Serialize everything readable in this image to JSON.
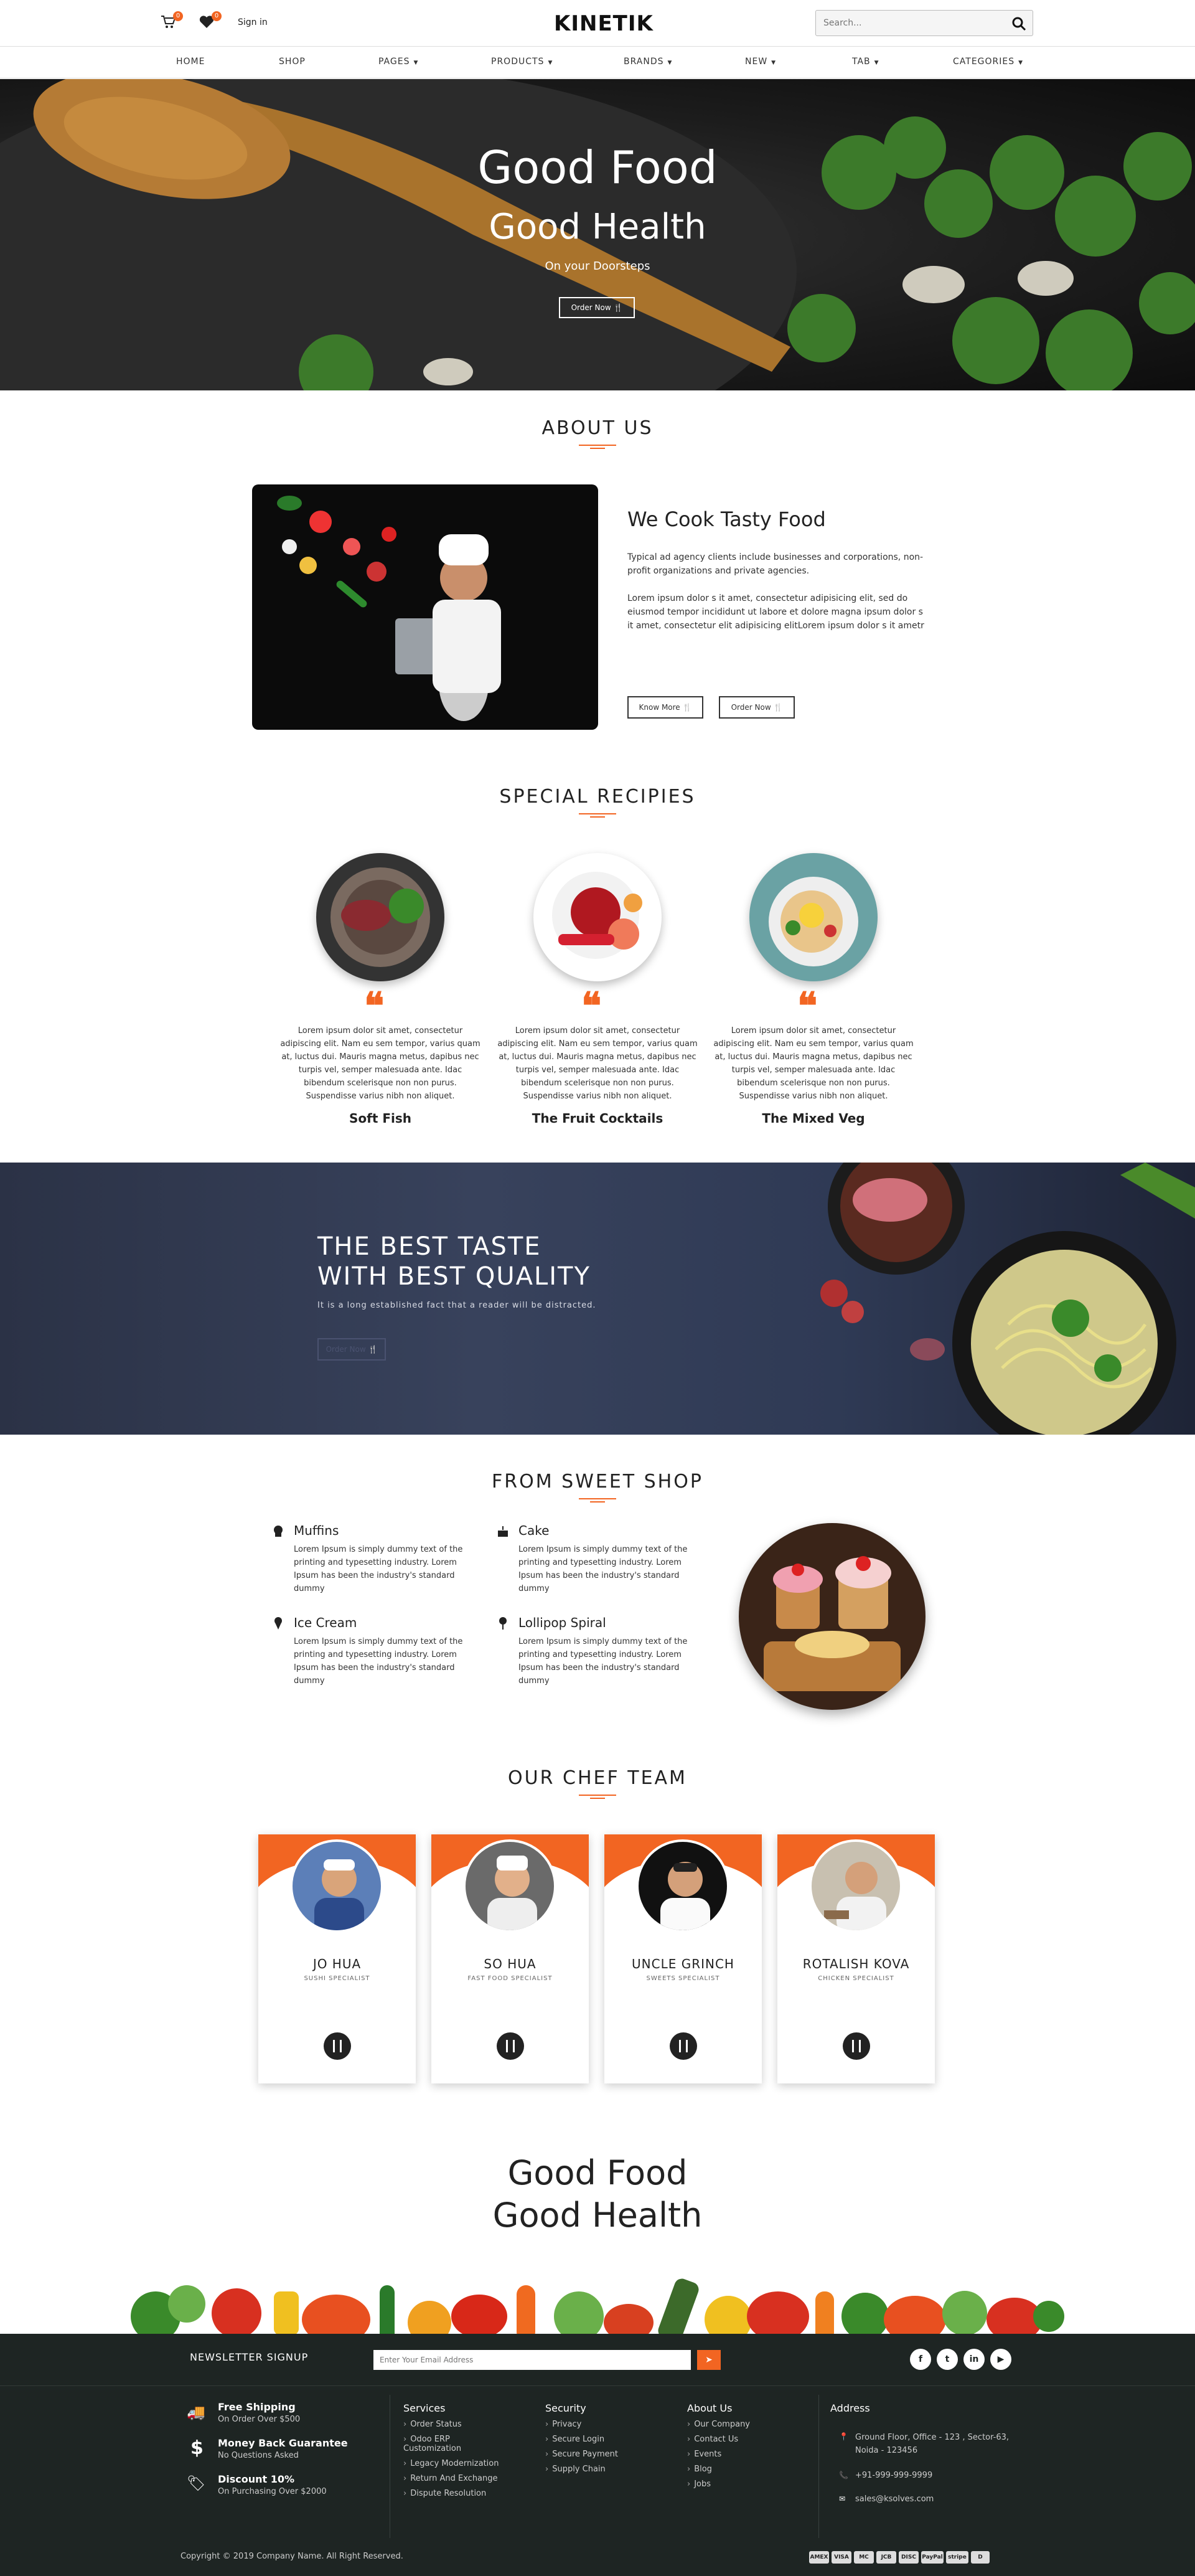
{
  "topbar": {
    "cart_count": "0",
    "wishlist_count": "0",
    "signin": "Sign in",
    "logo": "KINETIK",
    "search_placeholder": "Search..."
  },
  "nav": {
    "items": [
      {
        "label": "HOME",
        "dropdown": false
      },
      {
        "label": "SHOP",
        "dropdown": false
      },
      {
        "label": "PAGES",
        "dropdown": true
      },
      {
        "label": "PRODUCTS",
        "dropdown": true
      },
      {
        "label": "BRANDS",
        "dropdown": true
      },
      {
        "label": "NEW",
        "dropdown": true
      },
      {
        "label": "TAB",
        "dropdown": true
      },
      {
        "label": "CATEGORIES",
        "dropdown": true
      }
    ]
  },
  "hero": {
    "line1": "Good Food",
    "line2": "Good Health",
    "subtitle": "On your Doorsteps",
    "button": "Order Now"
  },
  "about": {
    "title": "ABOUT US",
    "heading": "We Cook Tasty Food",
    "para1": "Typical ad agency clients include businesses and corporations, non-profit organizations and private agencies.",
    "para2": "Lorem ipsum dolor s it amet, consectetur adipisicing elit, sed do eiusmod tempor incididunt ut labore et dolore magna ipsum dolor s it amet, consectetur elit adipisicing elitLorem ipsum dolor s it ametr",
    "btn_know": "Know More",
    "btn_order": "Order Now"
  },
  "recipes": {
    "title": "SPECIAL RECIPIES",
    "items": [
      {
        "name": "Soft Fish",
        "text": "Lorem ipsum dolor sit amet, consectetur adipiscing elit. Nam eu sem tempor, varius quam at, luctus dui. Mauris magna metus, dapibus nec turpis vel, semper malesuada ante. Idac bibendum scelerisque non non purus. Suspendisse varius nibh non aliquet."
      },
      {
        "name": "The Fruit Cocktails",
        "text": "Lorem ipsum dolor sit amet, consectetur adipiscing elit. Nam eu sem tempor, varius quam at, luctus dui. Mauris magna metus, dapibus nec turpis vel, semper malesuada ante. Idac bibendum scelerisque non non purus. Suspendisse varius nibh non aliquet."
      },
      {
        "name": "The Mixed Veg",
        "text": "Lorem ipsum dolor sit amet, consectetur adipiscing elit. Nam eu sem tempor, varius quam at, luctus dui. Mauris magna metus, dapibus nec turpis vel, semper malesuada ante. Idac bibendum scelerisque non non purus. Suspendisse varius nibh non aliquet."
      }
    ]
  },
  "banner": {
    "line1": "THE BEST TASTE",
    "line2": "WITH BEST QUALITY",
    "subtitle": "It is a long established fact that a reader will be distracted.",
    "button": "Order Now"
  },
  "sweet": {
    "title": "FROM SWEET SHOP",
    "items": [
      {
        "name": "Muffins",
        "icon": "muffin-icon",
        "text": "Lorem Ipsum is simply dummy text of the printing and typesetting industry. Lorem Ipsum has been the industry's standard dummy"
      },
      {
        "name": "Cake",
        "icon": "cake-icon",
        "text": "Lorem Ipsum is simply dummy text of the printing and typesetting industry. Lorem Ipsum has been the industry's standard dummy"
      },
      {
        "name": "Ice Cream",
        "icon": "ice-cream-icon",
        "text": "Lorem Ipsum is simply dummy text of the printing and typesetting industry. Lorem Ipsum has been the industry's standard dummy"
      },
      {
        "name": "Lollipop Spiral",
        "icon": "lollipop-icon",
        "text": "Lorem Ipsum is simply dummy text of the printing and typesetting industry. Lorem Ipsum has been the industry's standard dummy"
      }
    ]
  },
  "chefs": {
    "title": "OUR CHEF TEAM",
    "items": [
      {
        "name": "JO HUA",
        "role": "SUSHI SPECIALIST"
      },
      {
        "name": "SO HUA",
        "role": "FAST FOOD SPECIALIST"
      },
      {
        "name": "UNCLE GRINCH",
        "role": "SWEETS SPECIALIST"
      },
      {
        "name": "ROTALISH KOVA",
        "role": "CHICKEN SPECIALIST"
      }
    ]
  },
  "bottom_hero": {
    "line1": "Good Food",
    "line2": "Good Health"
  },
  "footer": {
    "newsletter_label": "NEWSLETTER SIGNUP",
    "email_placeholder": "Enter Your Email Address",
    "features": [
      {
        "title": "Free Shipping",
        "sub": "On Order Over $500",
        "icon": "truck-icon"
      },
      {
        "title": "Money Back Guarantee",
        "sub": "No Questions Asked",
        "icon": "dollar-icon"
      },
      {
        "title": "Discount 10%",
        "sub": "On Purchasing Over $2000",
        "icon": "tag-icon"
      }
    ],
    "services": {
      "title": "Services",
      "links": [
        "Order Status",
        "Odoo ERP Customization",
        "Legacy Modernization",
        "Return And Exchange",
        "Dispute Resolution"
      ]
    },
    "security": {
      "title": "Security",
      "links": [
        "Privacy",
        "Secure Login",
        "Secure Payment",
        "Supply Chain"
      ]
    },
    "about": {
      "title": "About Us",
      "links": [
        "Our Company",
        "Contact Us",
        "Events",
        "Blog",
        "Jobs"
      ]
    },
    "address": {
      "title": "Address",
      "location": "Ground Floor, Office - 123 , Sector-63, Noida - 123456",
      "phone": "+91-999-999-9999",
      "email": "sales@ksolves.com"
    },
    "copyright": "Copyright © 2019 Company Name. All Right Reserved.",
    "payments": [
      "AMEX",
      "VISA",
      "MC",
      "JCB",
      "DISC",
      "PayPal",
      "stripe",
      "D"
    ]
  },
  "colors": {
    "accent": "#f26522",
    "footer_bg": "#1e2523",
    "banner_bg": "#2f3a55"
  }
}
